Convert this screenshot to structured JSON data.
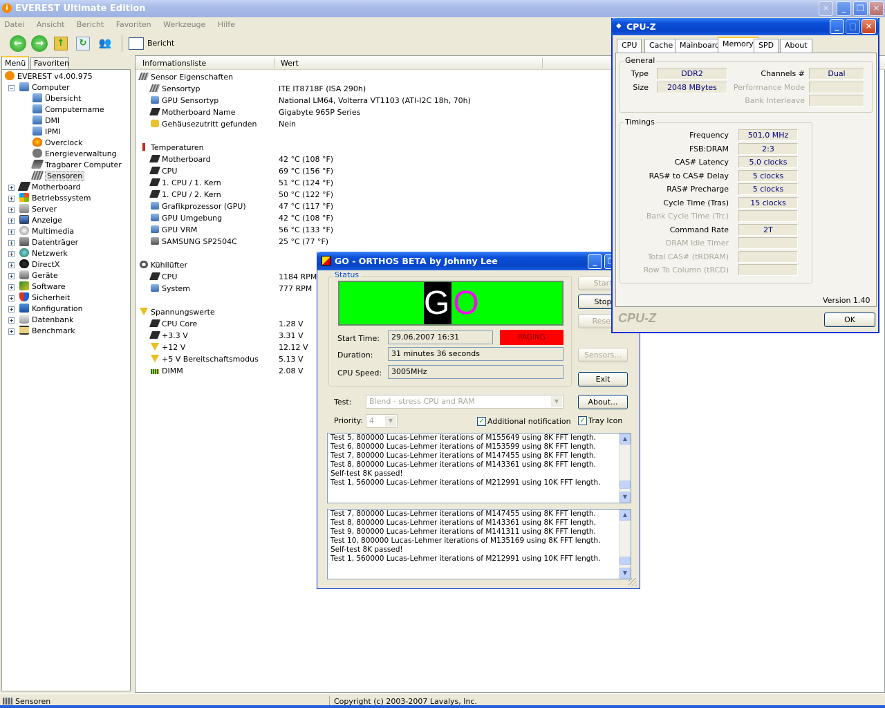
{
  "everest": {
    "title": "EVEREST Ultimate Edition",
    "menu": [
      "Datei",
      "Ansicht",
      "Bericht",
      "Favoriten",
      "Werkzeuge",
      "Hilfe"
    ],
    "toolbar": {
      "report_label": "Bericht"
    },
    "left_tabs": [
      "Menü",
      "Favoriten"
    ],
    "tree": [
      {
        "label": "EVEREST v4.00.975",
        "level": 0,
        "icon": "info-icon"
      },
      {
        "label": "Computer",
        "level": 1,
        "icon": "computer-icon",
        "expanded": true
      },
      {
        "label": "Übersicht",
        "level": 2,
        "icon": "computer-icon"
      },
      {
        "label": "Computername",
        "level": 2,
        "icon": "computer-icon"
      },
      {
        "label": "DMI",
        "level": 2,
        "icon": "computer-icon"
      },
      {
        "label": "IPMI",
        "level": 2,
        "icon": "computer-icon"
      },
      {
        "label": "Overclock",
        "level": 2,
        "icon": "flame-icon"
      },
      {
        "label": "Energieverwaltung",
        "level": 2,
        "icon": "power-icon"
      },
      {
        "label": "Tragbarer Computer",
        "level": 2,
        "icon": "laptop-icon"
      },
      {
        "label": "Sensoren",
        "level": 2,
        "icon": "sensor-icon",
        "selected": true
      },
      {
        "label": "Motherboard",
        "level": 1,
        "icon": "chip-icon"
      },
      {
        "label": "Betriebssystem",
        "level": 1,
        "icon": "windows-icon"
      },
      {
        "label": "Server",
        "level": 1,
        "icon": "server-icon"
      },
      {
        "label": "Anzeige",
        "level": 1,
        "icon": "display-icon"
      },
      {
        "label": "Multimedia",
        "level": 1,
        "icon": "multimedia-icon"
      },
      {
        "label": "Datenträger",
        "level": 1,
        "icon": "disk-icon"
      },
      {
        "label": "Netzwerk",
        "level": 1,
        "icon": "network-icon"
      },
      {
        "label": "DirectX",
        "level": 1,
        "icon": "directx-icon"
      },
      {
        "label": "Geräte",
        "level": 1,
        "icon": "devices-icon"
      },
      {
        "label": "Software",
        "level": 1,
        "icon": "software-icon"
      },
      {
        "label": "Sicherheit",
        "level": 1,
        "icon": "shield-icon"
      },
      {
        "label": "Konfiguration",
        "level": 1,
        "icon": "config-icon"
      },
      {
        "label": "Datenbank",
        "level": 1,
        "icon": "database-icon"
      },
      {
        "label": "Benchmark",
        "level": 1,
        "icon": "hourglass-icon"
      }
    ],
    "columns": [
      "Informationsliste",
      "Wert"
    ],
    "rows": [
      {
        "label": "Sensor Eigenschaften",
        "value": "",
        "section": true,
        "icon": "sensor-icon"
      },
      {
        "label": "Sensortyp",
        "value": "ITE IT8718F  (ISA 290h)",
        "icon": "sensor-icon"
      },
      {
        "label": "GPU Sensortyp",
        "value": "National LM64, Volterra VT1103  (ATI-I2C 18h, 70h)",
        "icon": "computer-icon"
      },
      {
        "label": "Motherboard Name",
        "value": "Gigabyte 965P Series",
        "icon": "chip-icon"
      },
      {
        "label": "Gehäusezutritt gefunden",
        "value": "Nein",
        "icon": "lock-icon"
      },
      {
        "label": "",
        "value": "",
        "spacer": true
      },
      {
        "label": "Temperaturen",
        "value": "",
        "section": true,
        "icon": "thermometer-icon"
      },
      {
        "label": "Motherboard",
        "value": "42 °C  (108 °F)",
        "icon": "chip-icon"
      },
      {
        "label": "CPU",
        "value": "69 °C  (156 °F)",
        "icon": "chip-icon"
      },
      {
        "label": "1. CPU / 1. Kern",
        "value": "51 °C  (124 °F)",
        "icon": "chip-icon"
      },
      {
        "label": "1. CPU / 2. Kern",
        "value": "50 °C  (122 °F)",
        "icon": "chip-icon"
      },
      {
        "label": "Grafikprozessor (GPU)",
        "value": "47 °C  (117 °F)",
        "icon": "computer-icon"
      },
      {
        "label": "GPU Umgebung",
        "value": "42 °C  (108 °F)",
        "icon": "computer-icon"
      },
      {
        "label": "GPU VRM",
        "value": "56 °C  (133 °F)",
        "icon": "computer-icon"
      },
      {
        "label": "SAMSUNG SP2504C",
        "value": "25 °C  (77 °F)",
        "icon": "disk-icon"
      },
      {
        "label": "",
        "value": "",
        "spacer": true
      },
      {
        "label": "Kühllüfter",
        "value": "",
        "section": true,
        "icon": "fan-icon"
      },
      {
        "label": "CPU",
        "value": "1184 RPM",
        "icon": "chip-icon"
      },
      {
        "label": "System",
        "value": "777 RPM",
        "icon": "computer-icon"
      },
      {
        "label": "",
        "value": "",
        "spacer": true
      },
      {
        "label": "Spannungswerte",
        "value": "",
        "section": true,
        "icon": "warning-icon"
      },
      {
        "label": "CPU Core",
        "value": "1.28 V",
        "icon": "chip-icon"
      },
      {
        "label": "+3.3 V",
        "value": "3.31 V",
        "icon": "chip-icon"
      },
      {
        "label": "+12 V",
        "value": "12.12 V",
        "icon": "warning-icon"
      },
      {
        "label": "+5 V Bereitschaftsmodus",
        "value": "5.13 V",
        "icon": "warning-icon"
      },
      {
        "label": "DIMM",
        "value": "2.08 V",
        "icon": "memory-icon"
      }
    ],
    "status_left": "Sensoren",
    "status_right": "Copyright (c) 2003-2007 Lavalys, Inc."
  },
  "cpuz": {
    "title": "CPU-Z",
    "tabs": [
      "CPU",
      "Cache",
      "Mainboard",
      "Memory",
      "SPD",
      "About"
    ],
    "active_tab": "Memory",
    "general_title": "General",
    "type_label": "Type",
    "type_value": "DDR2",
    "size_label": "Size",
    "size_value": "2048 MBytes",
    "channels_label": "Channels #",
    "channels_value": "Dual",
    "perf_label": "Performance Mode",
    "perf_value": "",
    "bank_label": "Bank Interleave",
    "bank_value": "",
    "timings_title": "Timings",
    "timings": [
      {
        "label": "Frequency",
        "value": "501.0 MHz",
        "enabled": true
      },
      {
        "label": "FSB:DRAM",
        "value": "2:3",
        "enabled": true
      },
      {
        "label": "CAS# Latency",
        "value": "5.0 clocks",
        "enabled": true
      },
      {
        "label": "RAS# to CAS# Delay",
        "value": "5 clocks",
        "enabled": true
      },
      {
        "label": "RAS# Precharge",
        "value": "5 clocks",
        "enabled": true
      },
      {
        "label": "Cycle Time (Tras)",
        "value": "15 clocks",
        "enabled": true
      },
      {
        "label": "Bank Cycle Time (Trc)",
        "value": "",
        "enabled": false
      },
      {
        "label": "Command Rate",
        "value": "2T",
        "enabled": true
      },
      {
        "label": "DRAM Idle Timer",
        "value": "",
        "enabled": false
      },
      {
        "label": "Total CAS# (tRDRAM)",
        "value": "",
        "enabled": false
      },
      {
        "label": "Row To Column (tRCD)",
        "value": "",
        "enabled": false
      }
    ],
    "version": "Version 1.40",
    "brand": "CPU-Z",
    "ok_label": "OK"
  },
  "orthos": {
    "title": "GO - ORTHOS BETA by Johnny Lee",
    "status_title": "Status",
    "go_text": "GO",
    "start_time_label": "Start Time:",
    "start_time_value": "29.06.2007 16:31",
    "paging_label": "PAGING",
    "duration_label": "Duration:",
    "duration_value": "31 minutes 36 seconds",
    "cpu_speed_label": "CPU Speed:",
    "cpu_speed_value": "3005MHz",
    "test_label": "Test:",
    "test_value": "Blend - stress CPU and RAM",
    "priority_label": "Priority:",
    "priority_value": "4",
    "additional_notification": "Additional notification",
    "tray_icon": "Tray Icon",
    "buttons": {
      "start": "Start",
      "stop": "Stop",
      "reset": "Reset",
      "sensors": "Sensors...",
      "exit": "Exit",
      "about": "About..."
    },
    "log1": [
      "Test 5, 800000 Lucas-Lehmer iterations of M155649 using 8K FFT length.",
      "Test 6, 800000 Lucas-Lehmer iterations of M153599 using 8K FFT length.",
      "Test 7, 800000 Lucas-Lehmer iterations of M147455 using 8K FFT length.",
      "Test 8, 800000 Lucas-Lehmer iterations of M143361 using 8K FFT length.",
      "Self-test 8K passed!",
      "Test 1, 560000 Lucas-Lehmer iterations of M212991 using 10K FFT length."
    ],
    "log2": [
      "Test 7, 800000 Lucas-Lehmer iterations of M147455 using 8K FFT length.",
      "Test 8, 800000 Lucas-Lehmer iterations of M143361 using 8K FFT length.",
      "Test 9, 800000 Lucas-Lehmer iterations of M141311 using 8K FFT length.",
      "Test 10, 800000 Lucas-Lehmer iterations of M135169 using 8K FFT length.",
      "Self-test 8K passed!",
      "Test 1, 560000 Lucas-Lehmer iterations of M212991 using 10K FFT length."
    ]
  },
  "colors": {
    "go_green": "#00ff00",
    "paging_red": "#ff0000",
    "xp_blue": "#0a4fd9",
    "value_blue": "#00007f"
  }
}
